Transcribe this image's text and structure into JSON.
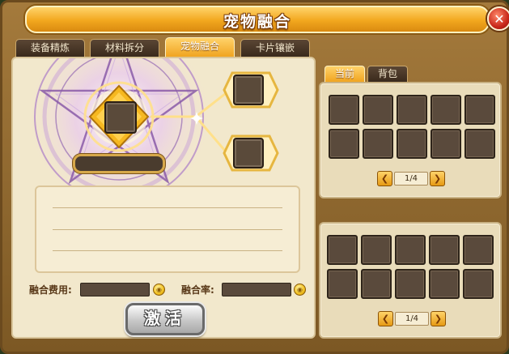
{
  "window": {
    "title": "宠物融合",
    "close_icon": "✕"
  },
  "tabs": [
    {
      "label": "装备精炼",
      "active": false
    },
    {
      "label": "材料拆分",
      "active": false
    },
    {
      "label": "宠物融合",
      "active": true
    },
    {
      "label": "卡片镶嵌",
      "active": false
    }
  ],
  "fusion": {
    "fee_label": "融合费用:",
    "rate_label": "融合率:",
    "fee_value": "",
    "rate_value": "",
    "coin_icon": "gold-coin-icon",
    "activate_label": "激活"
  },
  "inventory": {
    "tabs": [
      {
        "label": "当前",
        "active": true
      },
      {
        "label": "背包",
        "active": false
      }
    ],
    "top_pager": "1/4",
    "bottom_pager": "1/4",
    "prev_glyph": "❮",
    "next_glyph": "❯"
  },
  "colors": {
    "accent": "#f0a420",
    "frame": "#a47a3c",
    "panel": "#f2e8cc",
    "slot": "#5a4a3c"
  }
}
